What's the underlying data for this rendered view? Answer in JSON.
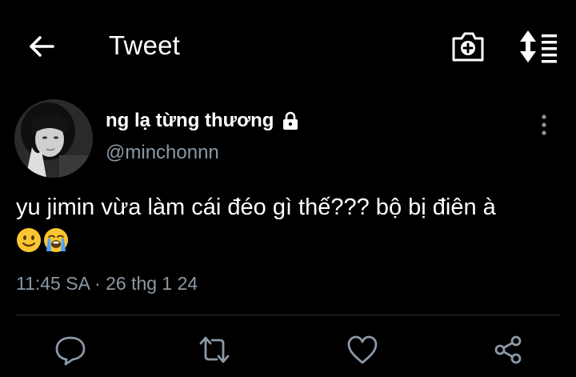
{
  "header": {
    "title": "Tweet",
    "back_icon": "arrow-left-icon",
    "camera_icon": "add-photo-icon",
    "sort_icon": "sort-icon"
  },
  "tweet": {
    "author_name": "ng lạ từng thương",
    "author_handle": "@minchonnn",
    "protected_icon": "lock-icon",
    "text": "yu jimin vừa làm cái đéo gì thế??? bộ bị điên à",
    "emojis": [
      "slightly-smiling-face",
      "loudly-crying-face"
    ],
    "timestamp": "11:45 SA · 26 thg 1 24"
  },
  "actions": [
    "reply-icon",
    "retweet-icon",
    "like-icon",
    "share-icon"
  ],
  "colors": {
    "background": "#000000",
    "primary_text": "#ffffff",
    "secondary_text": "#8b98a5",
    "divider": "#2f3336"
  }
}
